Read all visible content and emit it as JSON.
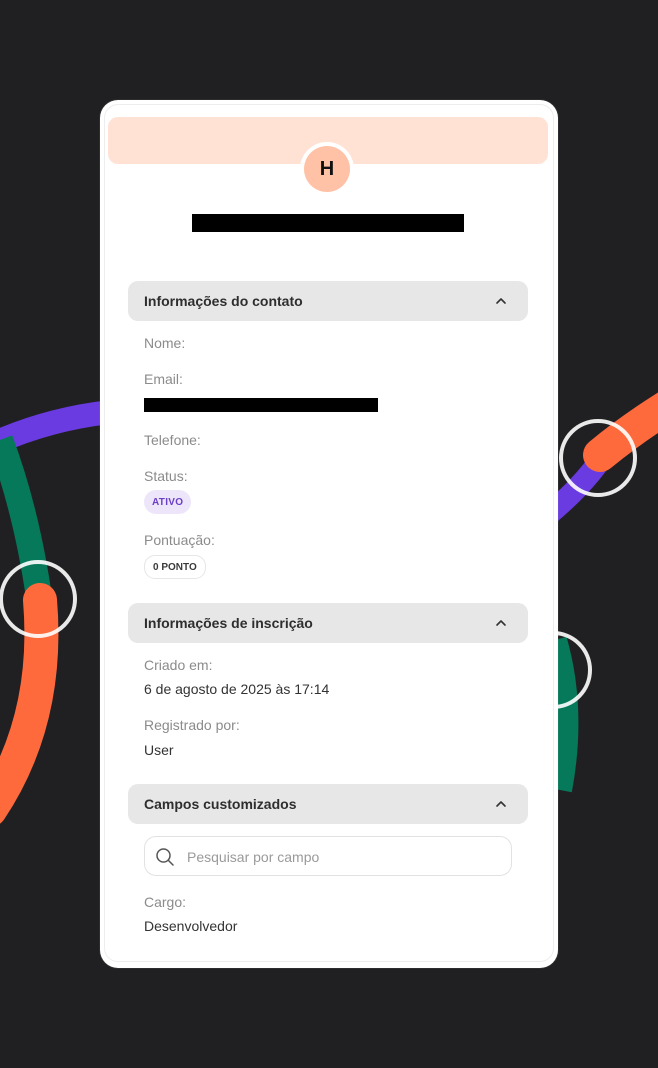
{
  "profile": {
    "avatar_initial": "H"
  },
  "contact_section": {
    "title": "Informações do contato",
    "name_label": "Nome:",
    "email_label": "Email:",
    "phone_label": "Telefone:",
    "status_label": "Status:",
    "status_badge": "ATIVO",
    "score_label": "Pontuação:",
    "score_badge": "0 PONTO"
  },
  "registration_section": {
    "title": "Informações de inscrição",
    "created_label": "Criado em:",
    "created_value": "6 de agosto de 2025 às 17:14",
    "registered_by_label": "Registrado por:",
    "registered_by_value": "User"
  },
  "custom_fields_section": {
    "title": "Campos customizados",
    "search_placeholder": "Pesquisar por campo",
    "cargo_label": "Cargo:",
    "cargo_value": "Desenvolvedor"
  },
  "colors": {
    "background": "#202023",
    "banner": "#ffe2d4",
    "avatar": "#ffc2a6",
    "badge_purple": "#6b3fc7",
    "decor_orange": "#ff6a3d",
    "decor_green": "#06795a",
    "decor_purple": "#6a3be0"
  }
}
